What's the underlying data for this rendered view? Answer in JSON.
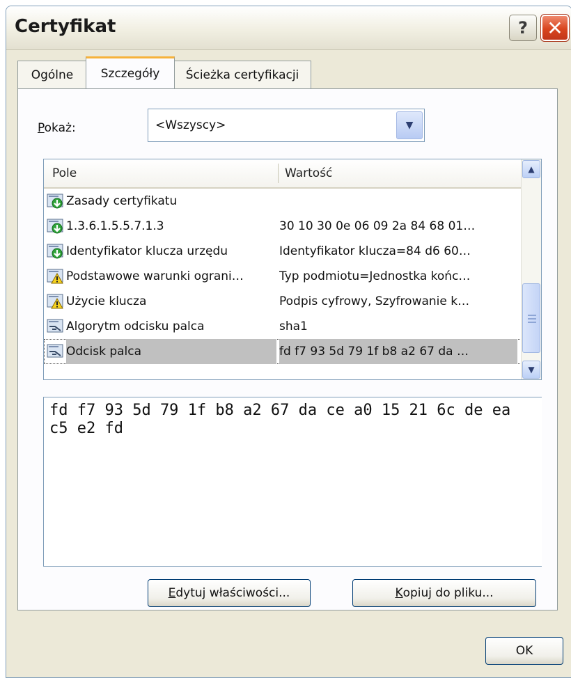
{
  "window": {
    "title": "Certyfikat"
  },
  "titlebar": {
    "help_label": "?",
    "close_label": "✕"
  },
  "tabs": [
    {
      "label": "Ogólne"
    },
    {
      "label": "Szczegóły"
    },
    {
      "label": "Ścieżka certyfikacji"
    }
  ],
  "show": {
    "label_accel": "P",
    "label_rest": "okaż:",
    "selected": "<Wszyscy>"
  },
  "fields_list": {
    "columns": [
      "Pole",
      "Wartość"
    ],
    "rows": [
      {
        "name": "Zasady certyfikatu",
        "value": "",
        "icon": "extension-critical-icon"
      },
      {
        "name": "1.3.6.1.5.5.7.1.3",
        "value": "30 10 30 0e 06 09 2a 84 68 01…",
        "icon": "extension-critical-icon"
      },
      {
        "name": "Identyfikator klucza urzędu",
        "value": "Identyfikator klucza=84 d6 60…",
        "icon": "extension-critical-icon"
      },
      {
        "name": "Podstawowe warunki ograni…",
        "value": "Typ podmiotu=Jednostka końc…",
        "icon": "extension-warning-icon"
      },
      {
        "name": "Użycie klucza",
        "value": "Podpis cyfrowy, Szyfrowanie k…",
        "icon": "extension-warning-icon"
      },
      {
        "name": "Algorytm odcisku palca",
        "value": "sha1",
        "icon": "property-icon"
      },
      {
        "name": "Odcisk palca",
        "value": "fd f7 93 5d 79 1f b8 a2 67 da …",
        "icon": "property-icon"
      }
    ],
    "selected_index": 6
  },
  "value_box": {
    "text": "fd f7 93 5d 79 1f b8 a2 67 da ce a0 15 21 6c de ea c5 e2 fd"
  },
  "buttons": {
    "edit": {
      "accel": "E",
      "rest": "dytuj właściwości..."
    },
    "copy": {
      "accel": "K",
      "rest": "opiuj do pliku..."
    },
    "ok": "OK"
  },
  "colors": {
    "accent_tab": "#f6b23a",
    "selection": "#c0c0c0",
    "close": "#d9451e",
    "border": "#7f9db9"
  }
}
